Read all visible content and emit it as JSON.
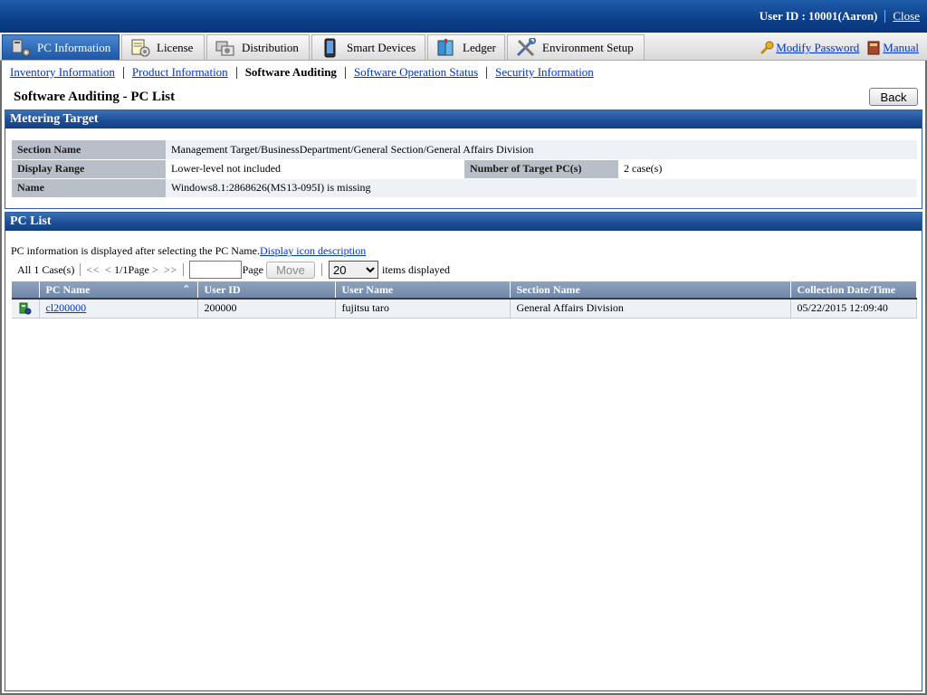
{
  "header": {
    "user_id_label": "User ID : 10001(Aaron)",
    "close_label": "Close"
  },
  "tabs": [
    {
      "label": "PC Information",
      "icon": "pc-icon",
      "active": true
    },
    {
      "label": "License",
      "icon": "license-icon",
      "active": false
    },
    {
      "label": "Distribution",
      "icon": "distribution-icon",
      "active": false
    },
    {
      "label": "Smart Devices",
      "icon": "smart-device-icon",
      "active": false
    },
    {
      "label": "Ledger",
      "icon": "ledger-icon",
      "active": false
    },
    {
      "label": "Environment Setup",
      "icon": "tools-icon",
      "active": false
    }
  ],
  "tab_links": {
    "modify_password": "Modify Password",
    "manual": "Manual"
  },
  "subnav": {
    "inventory": "Inventory Information",
    "product": "Product Information",
    "software_auditing": "Software Auditing",
    "operation_status": "Software Operation Status",
    "security": "Security Information"
  },
  "page": {
    "title": "Software Auditing - PC List",
    "back_label": "Back"
  },
  "metering": {
    "heading": "Metering Target",
    "section_name_label": "Section Name",
    "section_name_value": "Management Target/BusinessDepartment/General Section/General Affairs Division",
    "display_range_label": "Display Range",
    "display_range_value": "Lower-level not included",
    "target_pcs_label": "Number of Target PC(s)",
    "target_pcs_value": "2 case(s)",
    "name_label": "Name",
    "name_value": "Windows8.1:2868626(MS13-095I) is missing"
  },
  "pc_list": {
    "heading": "PC List",
    "note": "PC information is displayed after selecting the PC Name.",
    "icon_desc_link": "Display icon description",
    "total": "All 1 Case(s)",
    "first": "<<",
    "prev": "<",
    "page_info": "1/1Page",
    "next": ">",
    "last": ">>",
    "page_input_value": "",
    "page_label": "Page",
    "move_label": "Move",
    "per_page_value": "20",
    "items_displayed": "items displayed",
    "columns": [
      "PC Name",
      "User ID",
      "User Name",
      "Section Name",
      "Collection Date/Time"
    ],
    "rows": [
      {
        "pc_name": "cl200000",
        "user_id": "200000",
        "user_name": "fujitsu taro",
        "section_name": "General Affairs Division",
        "collected": "05/22/2015 12:09:40"
      }
    ]
  },
  "colors": {
    "header_blue": "#0c3f8a",
    "section_blue": "#1d4f97",
    "link": "#0033cc"
  }
}
